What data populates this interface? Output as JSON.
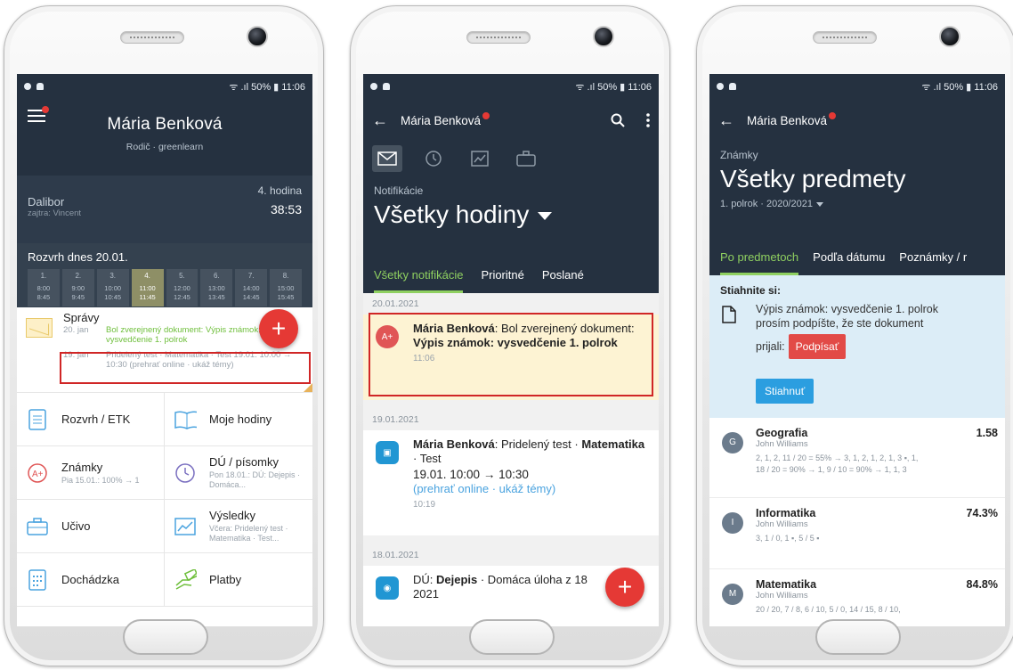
{
  "status": {
    "signal": "50%",
    "time": "11:06"
  },
  "phone1": {
    "user_name": "Mária Benková",
    "role": "Rodič · greenlearn",
    "lesson": {
      "teacher": "Dalibor",
      "tomorrow": "zajtra: Vincent",
      "hour": "4. hodina",
      "timer": "38:53"
    },
    "schedule": {
      "title": "Rozvrh dnes 20.01.",
      "periods": [
        {
          "n": "1.",
          "start": "8:00",
          "end": "8:45"
        },
        {
          "n": "2.",
          "start": "9:00",
          "end": "9:45"
        },
        {
          "n": "3.",
          "start": "10:00",
          "end": "10:45"
        },
        {
          "n": "4.",
          "start": "11:00",
          "end": "11:45"
        },
        {
          "n": "5.",
          "start": "12:00",
          "end": "12:45"
        },
        {
          "n": "6.",
          "start": "13:00",
          "end": "13:45"
        },
        {
          "n": "7.",
          "start": "14:00",
          "end": "14:45"
        },
        {
          "n": "8.",
          "start": "15:00",
          "end": "15:45"
        }
      ]
    },
    "messages": {
      "title": "Správy",
      "items": [
        {
          "date": "20. jan",
          "text": "Bol zverejnený dokument: Výpis známok: vysvedčenie 1. polrok"
        },
        {
          "date": "19. jan",
          "text": "Pridelený test · Matematika · Test 19.01. 10:00 → 10:30 (prehrať online · ukáž témy)"
        }
      ]
    },
    "tiles": [
      {
        "title": "Rozvrh / ETK",
        "sub": ""
      },
      {
        "title": "Moje hodiny",
        "sub": ""
      },
      {
        "title": "Známky",
        "sub": "Pia 15.01.: 100% → 1"
      },
      {
        "title": "DÚ / písomky",
        "sub": "Pon 18.01.: DÚ: Dejepis · Domáca..."
      },
      {
        "title": "Učivo",
        "sub": ""
      },
      {
        "title": "Výsledky",
        "sub": "Včera: Pridelený test · Matematika · Test..."
      },
      {
        "title": "Dochádzka",
        "sub": ""
      },
      {
        "title": "Platby",
        "sub": ""
      }
    ],
    "fab": "+"
  },
  "phone2": {
    "user_name": "Mária Benková",
    "section": "Notifikácie",
    "heading": "Všetky hodiny",
    "tabs": [
      "Všetky notifikácie",
      "Prioritné",
      "Poslané"
    ],
    "days": [
      {
        "date": "20.01.2021",
        "items": [
          {
            "icon": "A+",
            "sender": "Mária Benková",
            "text": ": Bol zverejnený dokument: ",
            "bold": "Výpis známok: vysvedčenie 1. polrok",
            "time": "11:06"
          }
        ]
      },
      {
        "date": "19.01.2021",
        "items": [
          {
            "sender": "Mária Benková",
            "text": ": Pridelený test · ",
            "bold": "Matematika",
            "rest": " · Test",
            "line2": "19.01. 10:00 → 10:30",
            "link": "(prehrať online · ukáž témy)",
            "time": "10:19"
          }
        ]
      },
      {
        "date": "18.01.2021",
        "items": [
          {
            "prefix": "DÚ: ",
            "bold": "Dejepis",
            "text": " · Domáca úloha z 18",
            "line2": "2021"
          }
        ]
      }
    ],
    "fab": "+"
  },
  "phone3": {
    "user_name": "Mária Benková",
    "section": "Známky",
    "heading": "Všetky predmety",
    "period": "1. polrok · 2020/2021",
    "tabs": [
      "Po predmetoch",
      "Podľa dátumu",
      "Poznámky / r"
    ],
    "download": {
      "title": "Stiahnite si:",
      "line1": "Výpis známok: vysvedčenie 1. polrok",
      "line2": "prosím podpíšte, že ste dokument",
      "line3": "prijali:",
      "sign": "Podpísať",
      "download_btn": "Stiahnuť"
    },
    "subjects": [
      {
        "initial": "G",
        "name": "Geografia",
        "teacher": "John Williams",
        "avg": "1.58",
        "grades1": "2, 1, 2, 11 / 20 = 55% → 3, 1, 2, 1, 2, 1, 3 ▪, 1,",
        "grades2": "18 / 20 = 90% → 1, 9 / 10 = 90% → 1, 1, 3"
      },
      {
        "initial": "I",
        "name": "Informatika",
        "teacher": "John Williams",
        "avg": "74.3%",
        "grades1": "3, 1 / 0, 1 ▪, 5 / 5 ▪",
        "grades2": ""
      },
      {
        "initial": "M",
        "name": "Matematika",
        "teacher": "John Williams",
        "avg": "84.8%",
        "grades1": "20 / 20, 7 / 8, 6 / 10, 5 / 0, 14 / 15, 8 / 10,",
        "grades2": ""
      }
    ]
  }
}
